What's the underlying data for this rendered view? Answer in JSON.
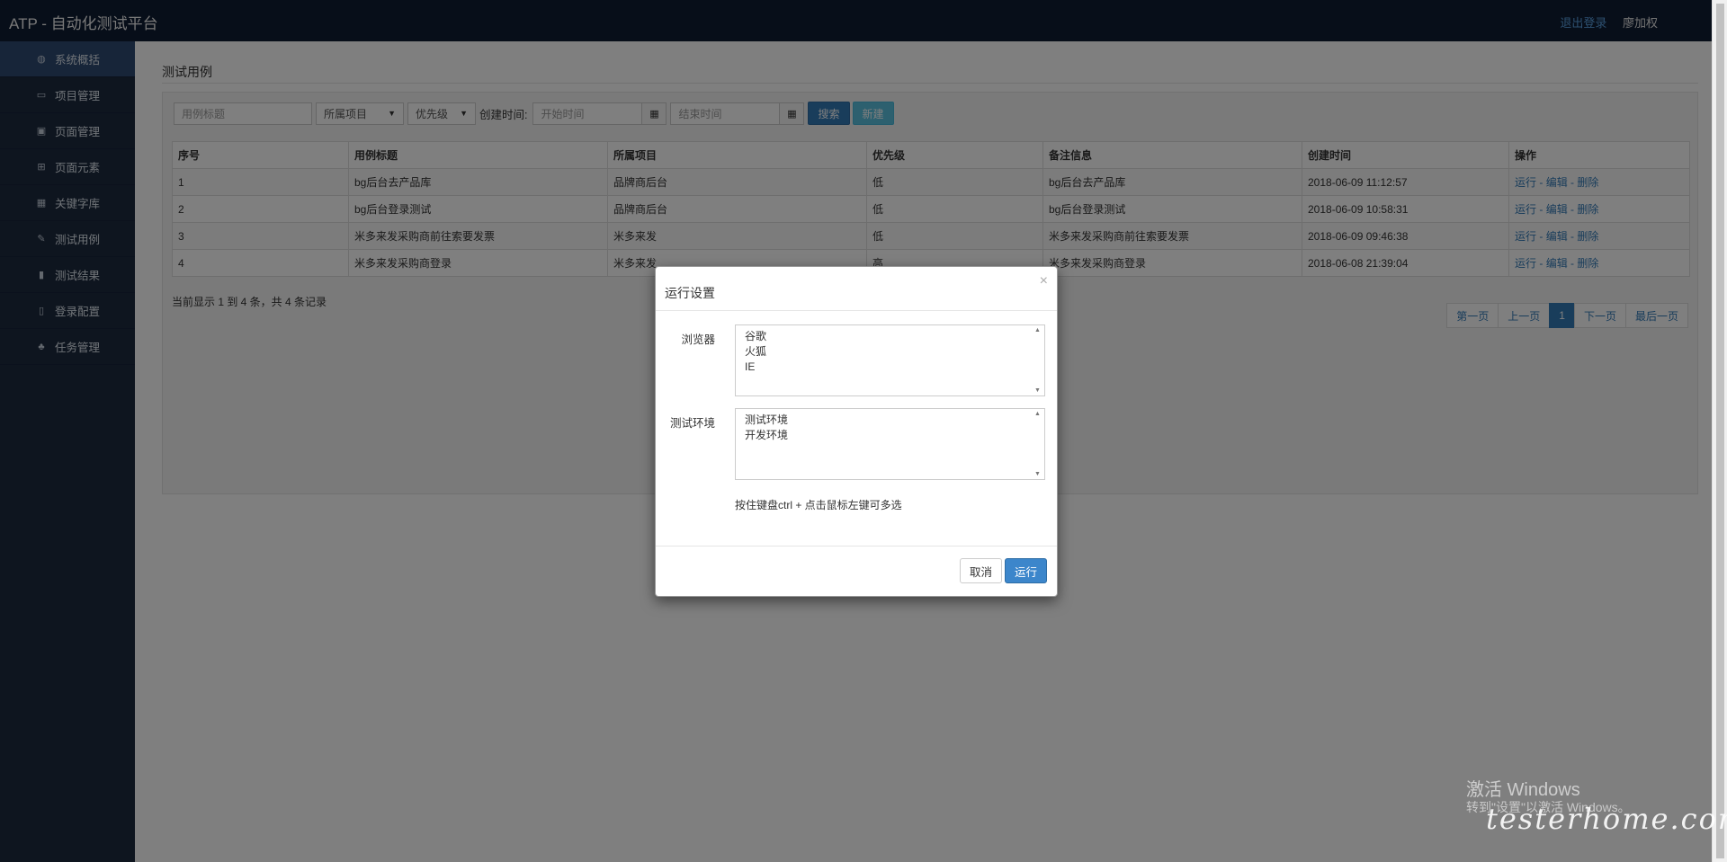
{
  "app": {
    "title": "ATP - 自动化测试平台"
  },
  "topbar": {
    "logout_label": "退出登录",
    "username": "廖加权"
  },
  "sidebar": {
    "items": [
      {
        "label": "系统概括",
        "icon": "dashboard-icon",
        "active": true
      },
      {
        "label": "项目管理",
        "icon": "monitor-icon"
      },
      {
        "label": "页面管理",
        "icon": "picture-icon"
      },
      {
        "label": "页面元素",
        "icon": "grid-icon"
      },
      {
        "label": "关键字库",
        "icon": "table-icon"
      },
      {
        "label": "测试用例",
        "icon": "edit-icon"
      },
      {
        "label": "测试结果",
        "icon": "file-icon"
      },
      {
        "label": "登录配置",
        "icon": "book-icon"
      },
      {
        "label": "任务管理",
        "icon": "sitemap-icon"
      }
    ]
  },
  "main": {
    "page_title": "测试用例",
    "filters": {
      "title_placeholder": "用例标题",
      "project_select": "所属项目",
      "priority_select": "优先级",
      "created_label": "创建时间:",
      "start_placeholder": "开始时间",
      "end_placeholder": "结束时间",
      "search_label": "搜索",
      "new_label": "新建"
    },
    "table": {
      "columns": [
        "序号",
        "用例标题",
        "所属项目",
        "优先级",
        "备注信息",
        "创建时间",
        "操作"
      ],
      "rows": [
        {
          "no": "1",
          "title": "bg后台去产品库",
          "project": "品牌商后台",
          "priority": "低",
          "remark": "bg后台去产品库",
          "created": "2018-06-09 11:12:57"
        },
        {
          "no": "2",
          "title": "bg后台登录测试",
          "project": "品牌商后台",
          "priority": "低",
          "remark": "bg后台登录测试",
          "created": "2018-06-09 10:58:31"
        },
        {
          "no": "3",
          "title": "米多来发采购商前往索要发票",
          "project": "米多来发",
          "priority": "低",
          "remark": "米多来发采购商前往索要发票",
          "created": "2018-06-09 09:46:38"
        },
        {
          "no": "4",
          "title": "米多来发采购商登录",
          "project": "米多来发",
          "priority": "高",
          "remark": "米多来发采购商登录",
          "created": "2018-06-08 21:39:04"
        }
      ],
      "actions": {
        "run": "运行",
        "edit": "编辑",
        "delete": "删除",
        "separator": " - "
      }
    },
    "summary": "当前显示 1 到 4 条，共 4 条记录",
    "pager": {
      "first": "第一页",
      "prev": "上一页",
      "current": "1",
      "next": "下一页",
      "last": "最后一页"
    }
  },
  "modal": {
    "title": "运行设置",
    "close": "×",
    "browser_label": "浏览器",
    "browser_options": [
      "谷歌",
      "火狐",
      "IE"
    ],
    "env_label": "测试环境",
    "env_options": [
      "测试环境",
      "开发环境"
    ],
    "hint": "按住键盘ctrl + 点击鼠标左键可多选",
    "cancel_label": "取消",
    "run_label": "运行"
  },
  "watermark": {
    "line1": "激活 Windows",
    "line2": "转到\"设置\"以激活 Windows。",
    "site": "testerhome.com"
  }
}
